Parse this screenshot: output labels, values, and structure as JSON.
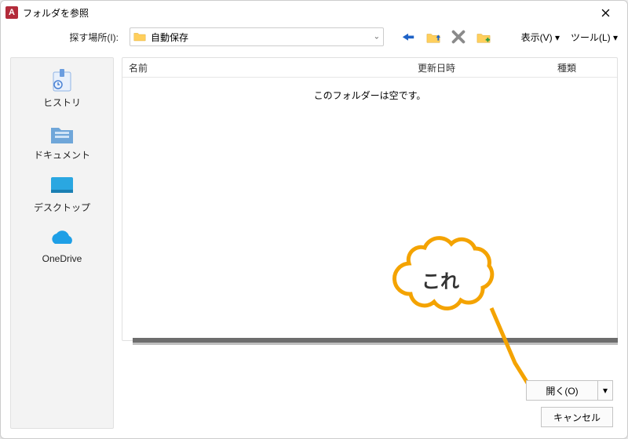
{
  "title": "フォルダを参照",
  "look_in_label": "探す場所(I):",
  "current_folder": "自動保存",
  "toolbar": {
    "view_label": "表示(V)",
    "tools_label": "ツール(L)"
  },
  "sidebar": {
    "items": [
      {
        "label": "ヒストリ"
      },
      {
        "label": "ドキュメント"
      },
      {
        "label": "デスクトップ"
      },
      {
        "label": "OneDrive"
      }
    ]
  },
  "columns": {
    "name": "名前",
    "date": "更新日時",
    "type": "種類"
  },
  "empty_message": "このフォルダーは空です。",
  "buttons": {
    "open": "開く(O)",
    "cancel": "キャンセル"
  },
  "callout_text": "これ",
  "colors": {
    "accent_orange": "#f4a300",
    "toolbar_blue": "#1f63c7"
  }
}
